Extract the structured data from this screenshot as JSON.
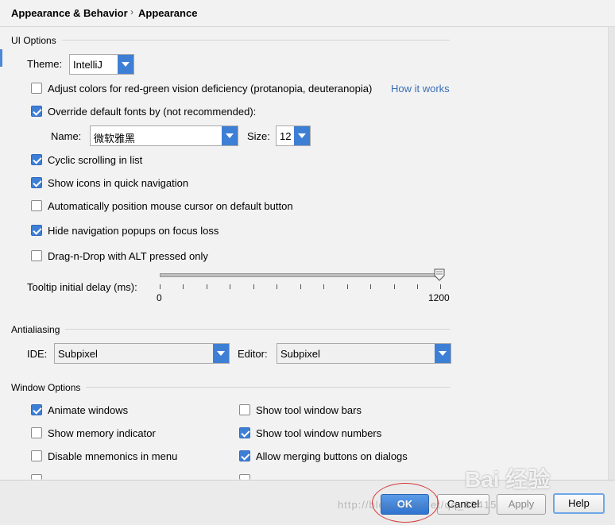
{
  "header": {
    "breadcrumb_parent": "Appearance & Behavior",
    "separator": "›",
    "breadcrumb_current": "Appearance"
  },
  "ui_options": {
    "title": "UI Options",
    "theme_label": "Theme:",
    "theme_value": "IntelliJ",
    "adjust_colors_label": "Adjust colors for red-green vision deficiency (protanopia, deuteranopia)",
    "adjust_colors_checked": false,
    "how_it_works": "How it works",
    "override_fonts_label": "Override default fonts by (not recommended):",
    "override_fonts_checked": true,
    "name_label": "Name:",
    "name_value": "微软雅黑",
    "size_label": "Size:",
    "size_value": "12",
    "checkboxes": [
      {
        "label": "Cyclic scrolling in list",
        "checked": true
      },
      {
        "label": "Show icons in quick navigation",
        "checked": true
      },
      {
        "label": "Automatically position mouse cursor on default button",
        "checked": false
      },
      {
        "label": "Hide navigation popups on focus loss",
        "checked": true
      },
      {
        "label": "Drag-n-Drop with ALT pressed only",
        "checked": false
      }
    ],
    "tooltip_label": "Tooltip initial delay (ms):",
    "tooltip_min": "0",
    "tooltip_max": "1200",
    "tooltip_value": 1200
  },
  "antialiasing": {
    "title": "Antialiasing",
    "ide_label": "IDE:",
    "ide_value": "Subpixel",
    "editor_label": "Editor:",
    "editor_value": "Subpixel"
  },
  "window_options": {
    "title": "Window Options",
    "left": [
      {
        "label": "Animate windows",
        "checked": true
      },
      {
        "label": "Show memory indicator",
        "checked": false
      },
      {
        "label": "Disable mnemonics in menu",
        "checked": false
      }
    ],
    "right": [
      {
        "label": "Show tool window bars",
        "checked": false
      },
      {
        "label": "Show tool window numbers",
        "checked": true
      },
      {
        "label": "Allow merging buttons on dialogs",
        "checked": true
      }
    ]
  },
  "footer": {
    "ok": "OK",
    "cancel": "Cancel",
    "apply": "Apply",
    "help": "Help"
  },
  "watermark": {
    "text": "http://blog.csdn.net/qq_33415",
    "brand": "Bai 经验"
  },
  "colors": {
    "accent": "#3e7fd6",
    "annotation": "#d63a3a",
    "link": "#3a6fb7"
  }
}
